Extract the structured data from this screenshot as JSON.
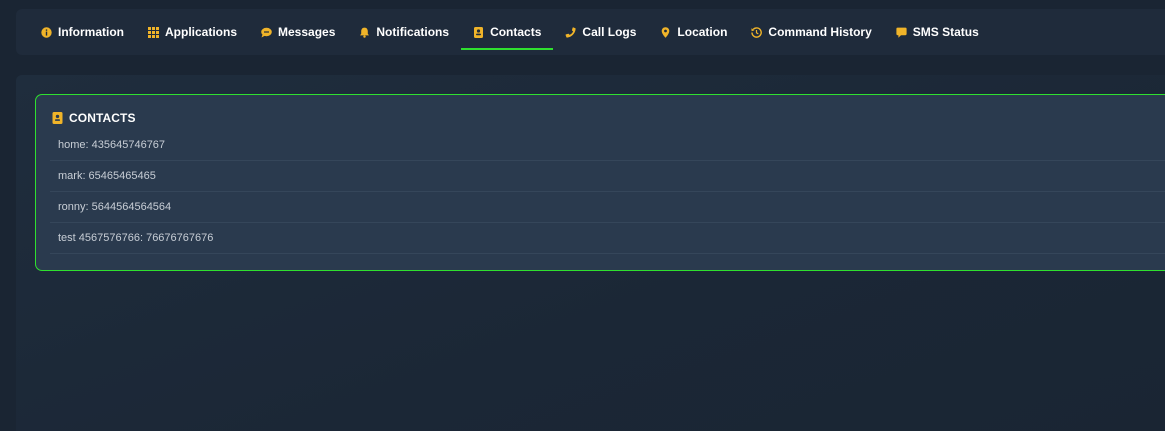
{
  "tabs": [
    {
      "label": "Information",
      "icon": "info-circle-icon",
      "active": false
    },
    {
      "label": "Applications",
      "icon": "grid-icon",
      "active": false
    },
    {
      "label": "Messages",
      "icon": "message-bubble-icon",
      "active": false
    },
    {
      "label": "Notifications",
      "icon": "bell-icon",
      "active": false
    },
    {
      "label": "Contacts",
      "icon": "contact-book-icon",
      "active": true
    },
    {
      "label": "Call Logs",
      "icon": "phone-icon",
      "active": false
    },
    {
      "label": "Location",
      "icon": "map-pin-icon",
      "active": false
    },
    {
      "label": "Command History",
      "icon": "history-icon",
      "active": false
    },
    {
      "label": "SMS Status",
      "icon": "sms-icon",
      "active": false
    }
  ],
  "contacts_card": {
    "title": "CONTACTS",
    "icon": "contact-book-icon",
    "items": [
      "home: 435645746767",
      "mark: 65465465465",
      "ronny: 5644564564564",
      "test 4567576766: 76676767676"
    ]
  },
  "colors": {
    "background": "#1a2533",
    "panel": "#1f2b3b",
    "card": "#2a3a4e",
    "accent_green": "#2fe02f",
    "icon_orange": "#f0b429",
    "text": "#ffffff",
    "muted_text": "#c8ced6"
  }
}
